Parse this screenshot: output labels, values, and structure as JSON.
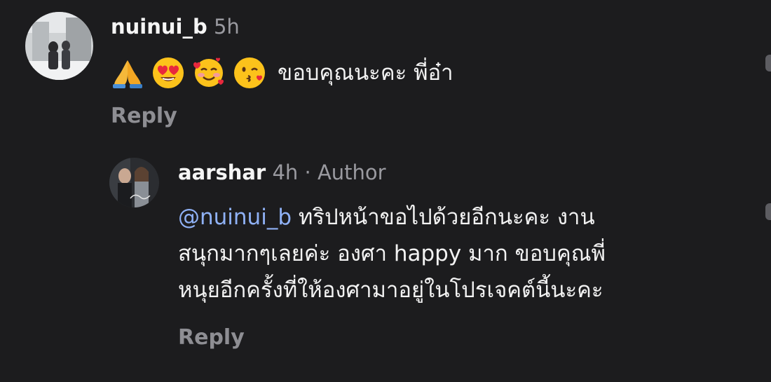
{
  "comment": {
    "username": "nuinui_b",
    "time": "5h",
    "emojis": [
      "folded-hands-emoji",
      "heart-eyes-emoji",
      "smiling-face-with-hearts-emoji",
      "kissing-face-emoji"
    ],
    "text": "ขอบคุณนะคะ พี่อ๋า",
    "reply_label": "Reply"
  },
  "reply": {
    "username": "aarshar",
    "time": "4h",
    "separator": "·",
    "author_label": "Author",
    "mention": "@nuinui_b",
    "line1_rest": "ทริปหน้าขอไปด้วยอีกนะคะ งาน",
    "line2": "สนุกมากๆเลยค่ะ องศา happy มาก ขอบคุณพี่",
    "line3": "หนุยอีกครั้งที่ให้องศามาอยู่ในโปรเจคต์นี้นะคะ",
    "reply_label": "Reply"
  },
  "colors": {
    "background": "#1c1c1e",
    "username": "#f5f5f5",
    "meta": "#9a9aa0",
    "mention": "#8fb1f5",
    "reply_link": "#8e8e93"
  }
}
